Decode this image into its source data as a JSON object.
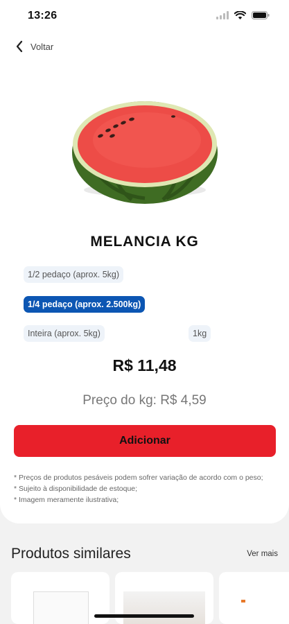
{
  "status_bar": {
    "time": "13:26"
  },
  "nav": {
    "back_label": "Voltar"
  },
  "product": {
    "title": "MELANCIA KG",
    "options": [
      "1/2 pedaço (aprox. 5kg)",
      "1/4 pedaço (aprox. 2.500kg)",
      "Inteira (aprox. 5kg)",
      "1kg"
    ],
    "selected_option": "1/4 pedaço (aprox. 2.500kg)",
    "price": "R$ 11,48",
    "price_per_kg": "Preço do kg: R$ 4,59",
    "add_label": "Adicionar",
    "notes": [
      "* Preços de produtos pesáveis podem sofrer variação de acordo com o peso;",
      "* Sujeito à disponibilidade de estoque;",
      "* Imagem meramente ilustrativa;"
    ]
  },
  "similar": {
    "title": "Produtos similares",
    "see_more": "Ver mais"
  },
  "colors": {
    "accent_red": "#e8202a",
    "selected_blue": "#0c56b3",
    "chip_bg": "#eef3f9",
    "background": "#f2f2f2"
  },
  "icons": [
    "signal-icon",
    "wifi-icon",
    "battery-icon",
    "chevron-left-icon"
  ]
}
